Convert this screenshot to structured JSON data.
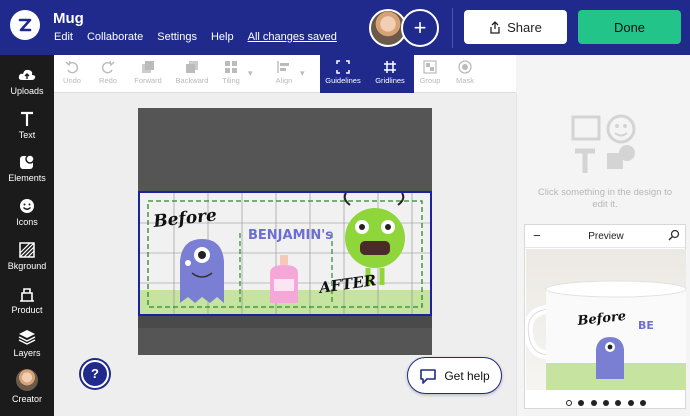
{
  "header": {
    "title": "Mug",
    "menu": [
      "Edit",
      "Collaborate",
      "Settings",
      "Help"
    ],
    "saved_status": "All changes saved",
    "share_label": "Share",
    "done_label": "Done",
    "add_collaborator": "+"
  },
  "sidebar": {
    "items": [
      {
        "label": "Uploads",
        "icon": "cloud-upload-icon"
      },
      {
        "label": "Text",
        "icon": "text-icon"
      },
      {
        "label": "Elements",
        "icon": "elements-icon"
      },
      {
        "label": "Icons",
        "icon": "smiley-icon"
      },
      {
        "label": "Bkground",
        "icon": "background-icon"
      },
      {
        "label": "Product",
        "icon": "product-icon"
      },
      {
        "label": "Layers",
        "icon": "layers-icon"
      },
      {
        "label": "Creator",
        "icon": "avatar"
      }
    ]
  },
  "toolbar": {
    "undo": "Undo",
    "redo": "Redo",
    "forward": "Forward",
    "backward": "Backward",
    "tiling": "Tiling",
    "align": "Align",
    "guidelines": "Guidelines",
    "gridlines": "Gridlines",
    "group": "Group",
    "mask": "Mask"
  },
  "design": {
    "before_text": "Before",
    "name_text": "BENJAMIN's",
    "after_text": "AFTER"
  },
  "right_panel": {
    "empty_message": "Click something in the design to edit it."
  },
  "preview": {
    "title": "Preview",
    "mug_text_before": "Before",
    "mug_text_name": "BE",
    "pages": 7,
    "active_page": 1
  },
  "help": {
    "help_icon": "?",
    "get_help_label": "Get help"
  },
  "colors": {
    "brand_blue": "#1f2a8c",
    "done_green": "#22c48a",
    "sidebar_bg": "#1b1b1b"
  }
}
